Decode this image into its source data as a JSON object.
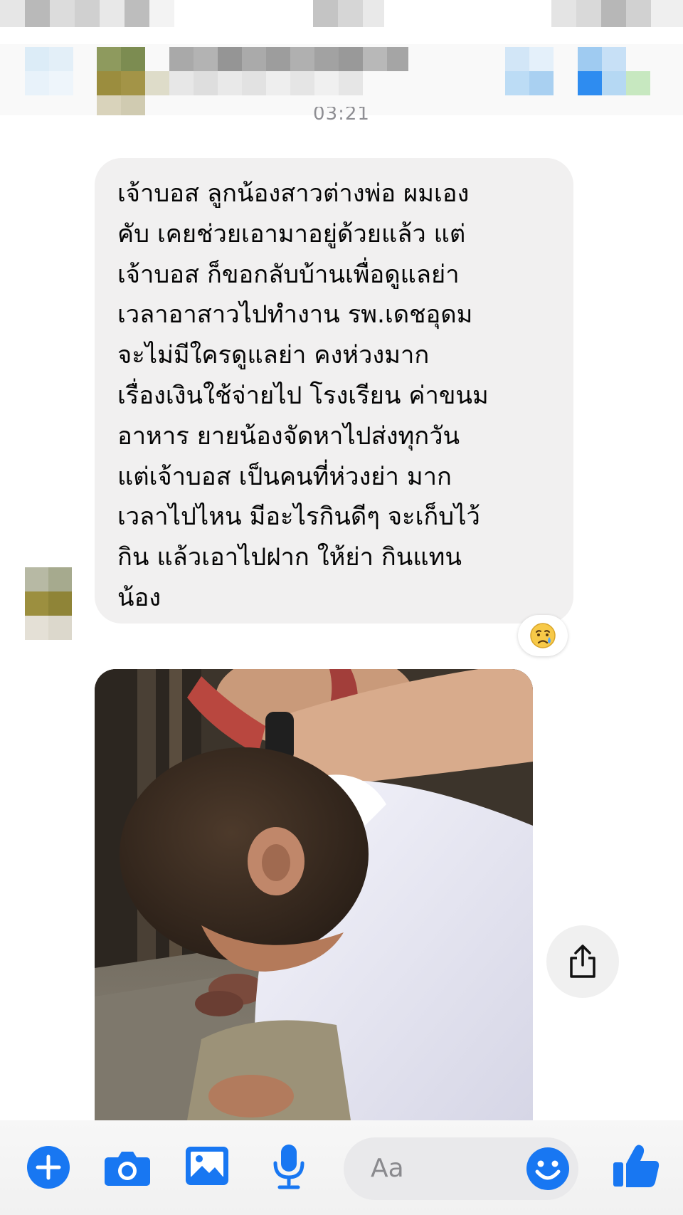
{
  "thread": {
    "timestamp": "03:21"
  },
  "message": {
    "lines": [
      "เจ้าบอส ลูกน้องสาวต่างพ่อ ผมเอง",
      "คับ เคยช่วยเอามาอยู่ด้วยแล้ว แต่",
      "เจ้าบอส ก็ขอกลับบ้านเพื่อดูแลย่า",
      "เวลาอาสาวไปทำงาน รพ.เดชอุดม",
      "จะไม่มีใครดูแลย่า คงห่วงมาก",
      "เรื่องเงินใช้จ่ายไป โรงเรียน ค่าขนม",
      "อาหาร ยายน้องจัดหาไปส่งทุกวัน",
      "แต่เจ้าบอส เป็นคนที่ห่วงย่า มาก",
      "เวลาไปไหน มีอะไรกินดีๆ จะเก็บไว้",
      "กิน แล้วเอาไปฝาก ให้ย่า กินแทน",
      "น้อง"
    ],
    "reaction": "😥"
  },
  "composer": {
    "placeholder": "Aa"
  },
  "icons": {
    "add": "plus-circle",
    "camera": "camera",
    "gallery": "photo-gallery",
    "microphone": "microphone",
    "emoji": "smiley-face",
    "like": "thumbs-up",
    "share": "share-upload"
  },
  "colors": {
    "accent": "#1877f2",
    "bubble": "#f1f0f0",
    "timestamp": "#8e8e93"
  }
}
